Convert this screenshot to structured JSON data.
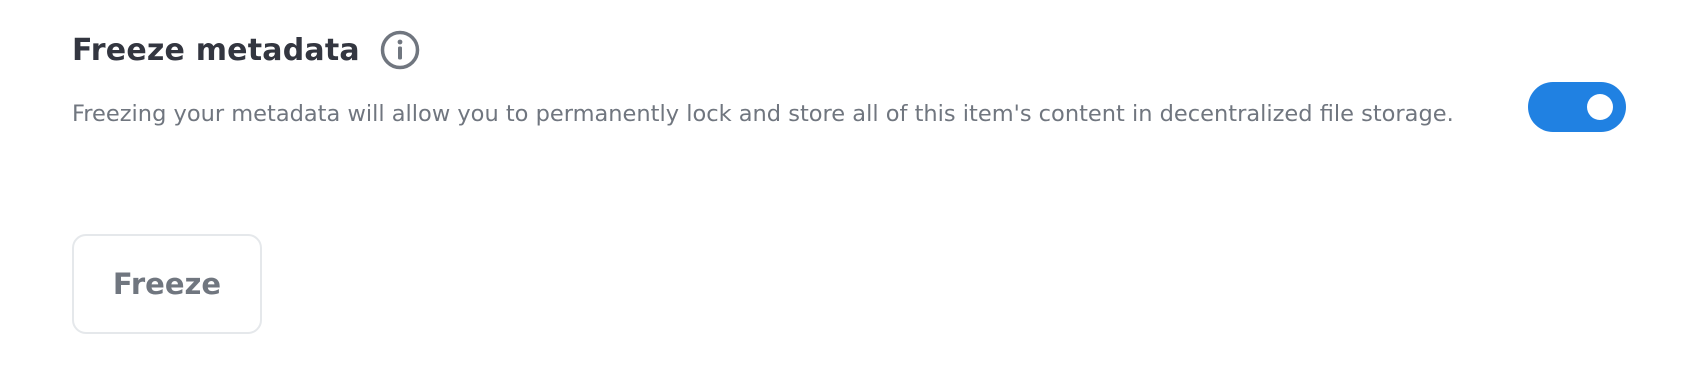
{
  "section": {
    "title": "Freeze metadata",
    "info_icon": "info-circle-icon",
    "description": "Freezing your metadata will allow you to permanently lock and store all of this item's content in decentralized file storage."
  },
  "toggle": {
    "state": "on",
    "color_on": "#2081e2"
  },
  "actions": {
    "freeze_label": "Freeze"
  }
}
